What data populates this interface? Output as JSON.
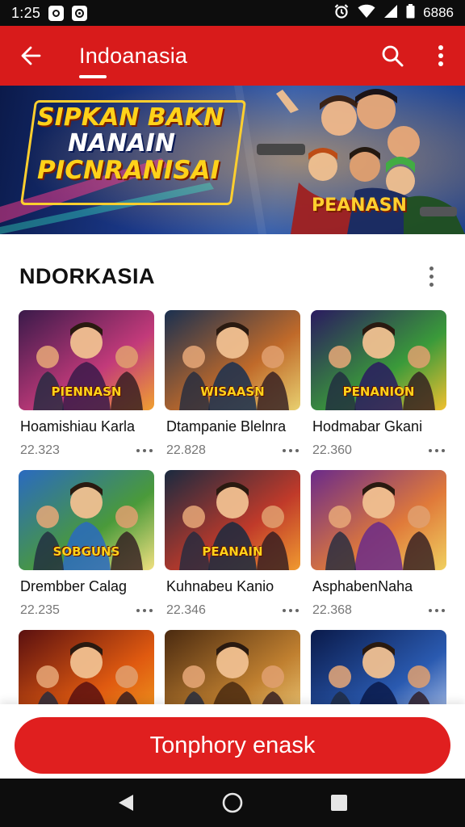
{
  "status_bar": {
    "time": "1:25",
    "battery_text": "6886",
    "icons": [
      "app-icon-1",
      "app-icon-2",
      "alarm-icon",
      "wifi-icon",
      "signal-icon",
      "battery-icon"
    ]
  },
  "app_bar": {
    "title": "Indoanasia",
    "icons": [
      "back-arrow-icon",
      "search-icon",
      "more-vert-icon"
    ]
  },
  "banner": {
    "line1": "SIPKAN BAKN",
    "line2": "NANAIN",
    "line3": "PICNRANISAI",
    "logo_text": "PEANASN"
  },
  "section": {
    "title": "NDORKASIA"
  },
  "cards": [
    {
      "title": "Hoamishiau Karla",
      "count": "22.323",
      "thumb_text": "PIENNASN",
      "palette": [
        "#3a1a4a",
        "#c23a7a",
        "#f0a030"
      ]
    },
    {
      "title": "Dtampanie Blelnra",
      "count": "22.828",
      "thumb_text": "WISAASN",
      "palette": [
        "#1a3050",
        "#c06a2a",
        "#e8d070"
      ]
    },
    {
      "title": "Hodmabar Gkani",
      "count": "22.360",
      "thumb_text": "PENANION",
      "palette": [
        "#2a1a60",
        "#3a9a3a",
        "#f0c030"
      ]
    },
    {
      "title": "Drembber Calag",
      "count": "22.235",
      "thumb_text": "SOBGUNS",
      "palette": [
        "#2a6ac0",
        "#4a9a3a",
        "#f0e080"
      ]
    },
    {
      "title": "Kuhnabeu Kanio",
      "count": "22.346",
      "thumb_text": "PEANAIN",
      "palette": [
        "#1a2a40",
        "#c03a2a",
        "#f09a30"
      ]
    },
    {
      "title": "AsphabenNaha",
      "count": "22.368",
      "thumb_text": "",
      "palette": [
        "#6a2a8a",
        "#e07a3a",
        "#f0d060"
      ]
    },
    {
      "title": "",
      "count": "",
      "thumb_text": "",
      "palette": [
        "#5a1010",
        "#e05a10",
        "#f0a020"
      ]
    },
    {
      "title": "",
      "count": "",
      "thumb_text": "",
      "palette": [
        "#4a2a10",
        "#c08030",
        "#f0d080"
      ]
    },
    {
      "title": "",
      "count": "",
      "thumb_text": "",
      "palette": [
        "#0a1a4a",
        "#2a5ab0",
        "#c0d0f0"
      ]
    }
  ],
  "action_button": {
    "label": "Tonphory enask"
  },
  "nav_bar": {
    "icons": [
      "nav-back-icon",
      "nav-home-icon",
      "nav-recents-icon"
    ]
  },
  "colors": {
    "brand_red": "#d81b1b",
    "button_red": "#e01f1f",
    "banner_yellow": "#ffd21a"
  }
}
